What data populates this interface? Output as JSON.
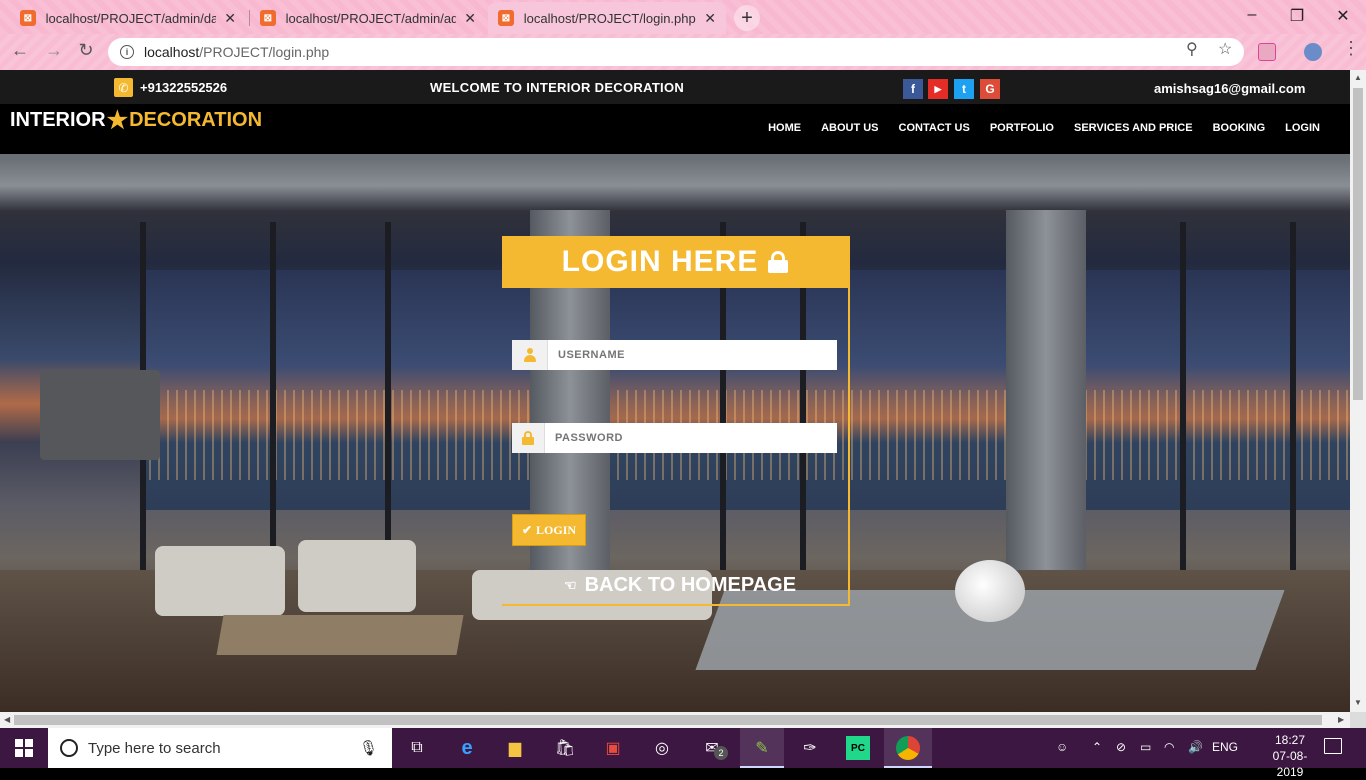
{
  "browser": {
    "tabs": [
      {
        "title": "localhost/PROJECT/admin/dashb",
        "active": false
      },
      {
        "title": "localhost/PROJECT/admin/admin",
        "active": false
      },
      {
        "title": "localhost/PROJECT/login.php",
        "active": true
      }
    ],
    "url_host": "localhost",
    "url_path": "/PROJECT/login.php",
    "new_tab": "+",
    "close": "✕"
  },
  "topbar": {
    "phone": "+91322552526",
    "welcome": "WELCOME TO INTERIOR DECORATION",
    "email": "amishsag16@gmail.com",
    "social": [
      {
        "icon": "facebook-icon",
        "glyph": "f",
        "color": "#3b5998"
      },
      {
        "icon": "youtube-icon",
        "glyph": "▶",
        "color": "#e52d27"
      },
      {
        "icon": "twitter-icon",
        "glyph": "t",
        "color": "#1da1f2"
      },
      {
        "icon": "google-plus-icon",
        "glyph": "G",
        "color": "#dd4b39"
      }
    ]
  },
  "brand": {
    "word1": "INTERIOR",
    "word2": "DECORATION",
    "accent": "#f5b931"
  },
  "nav": {
    "items": [
      "HOME",
      "ABOUT US",
      "CONTACT US",
      "PORTFOLIO",
      "SERVICES AND PRICE",
      "BOOKING",
      "LOGIN"
    ]
  },
  "login": {
    "title": "LOGIN HERE",
    "username_placeholder": "USERNAME",
    "password_placeholder": "PASSWORD",
    "button_label": "LOGIN",
    "back_label": "BACK TO HOMEPAGE"
  },
  "taskbar": {
    "search_placeholder": "Type here to search",
    "mail_badge": "2",
    "language": "ENG",
    "time": "18:27",
    "date": "07-08-2019"
  }
}
